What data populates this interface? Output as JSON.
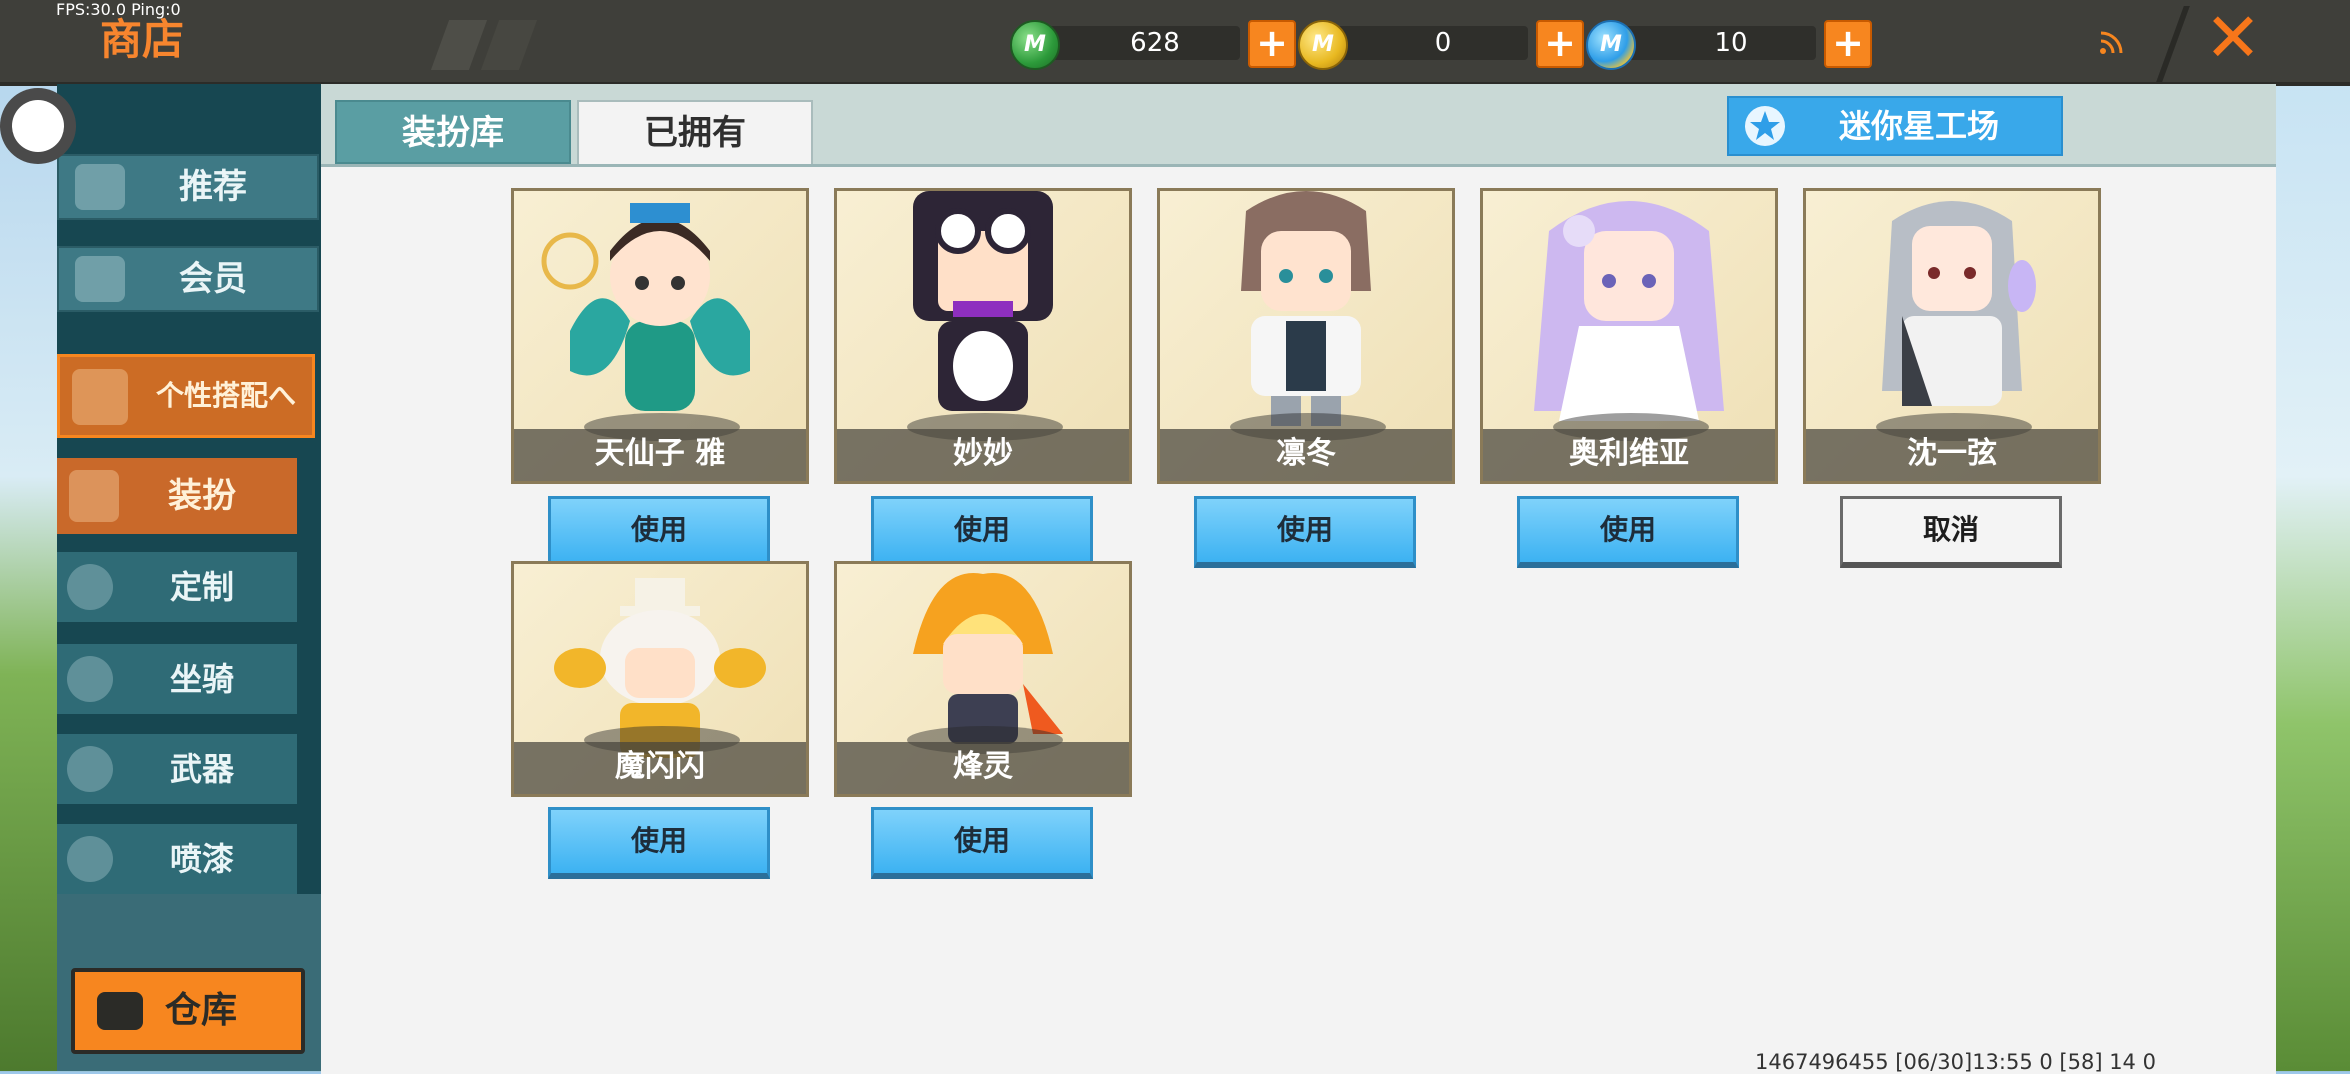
{
  "status": {
    "fps": "FPS:30.0  Ping:0"
  },
  "header": {
    "title": "商店"
  },
  "currencies": [
    {
      "icon": "green-gem-coin-icon",
      "value": "628"
    },
    {
      "icon": "gold-m-coin-icon",
      "value": "0"
    },
    {
      "icon": "blue-m-coin-icon",
      "value": "10"
    }
  ],
  "sidebar": {
    "items": [
      {
        "label": "推荐",
        "icon": "thumbs-up-icon"
      },
      {
        "label": "会员",
        "icon": "vip-l-icon"
      },
      {
        "label": "个性搭配へ",
        "icon": "trophy-icon"
      },
      {
        "label": "装扮",
        "icon": "shirt-icon"
      },
      {
        "label": "定制",
        "icon": "pencil-icon"
      },
      {
        "label": "坐骑",
        "icon": "mount-icon"
      },
      {
        "label": "武器",
        "icon": "gun-icon"
      },
      {
        "label": "喷漆",
        "icon": "spray-can-icon"
      }
    ],
    "warehouse_label": "仓库"
  },
  "tabs": [
    {
      "label": "装扮库",
      "active": true
    },
    {
      "label": "已拥有",
      "active": false
    }
  ],
  "studio_button": "迷你星工场",
  "skins": [
    {
      "name": "天仙子 雅",
      "action": "使用"
    },
    {
      "name": "妙妙",
      "action": "使用"
    },
    {
      "name": "凛冬",
      "action": "使用"
    },
    {
      "name": "奥利维亚",
      "action": "使用"
    },
    {
      "name": "沈一弦",
      "action": "取消"
    },
    {
      "name": "魔闪闪",
      "action": "使用"
    },
    {
      "name": "烽灵",
      "action": "使用"
    }
  ],
  "footer": "1467496455   [06/30]13:55 0  [58] 14 0",
  "colors": {
    "accent_orange": "#f7861f",
    "use_button_blue": "#3cb2f2",
    "sidebar_teal": "#3e7985"
  }
}
